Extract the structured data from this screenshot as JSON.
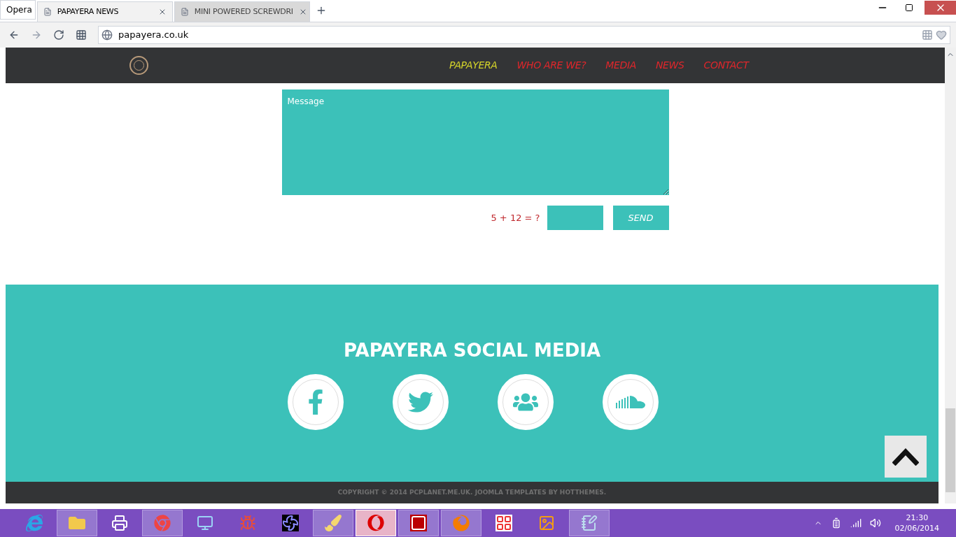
{
  "browser": {
    "brand": "Opera",
    "tabs": [
      {
        "label": "PAPAYERA NEWS",
        "selected": true
      },
      {
        "label": "MINI POWERED SCREWDRI",
        "selected": false
      }
    ],
    "address": "papayera.co.uk"
  },
  "nav": {
    "items": [
      {
        "label": "PAPAYERA",
        "selected": true
      },
      {
        "label": "WHO ARE WE?",
        "selected": false
      },
      {
        "label": "MEDIA",
        "selected": false
      },
      {
        "label": "NEWS",
        "selected": false
      },
      {
        "label": "CONTACT",
        "selected": false
      }
    ]
  },
  "form": {
    "message_placeholder": "Message",
    "captcha": "5 + 12 = ?",
    "send": "SEND"
  },
  "social": {
    "title": "PAPAYERA SOCIAL MEDIA",
    "links": [
      {
        "kind": "facebook"
      },
      {
        "kind": "twitter"
      },
      {
        "kind": "people"
      },
      {
        "kind": "soundcloud"
      }
    ]
  },
  "copyright": "COPYRIGHT © 2014 PCPLANET.ME.UK. **JOOMLA TEMPLATES** BY HOTTHEMES.",
  "taskbar": {
    "apps": [
      {
        "kind": "ie",
        "running": false,
        "selected": false
      },
      {
        "kind": "folder",
        "running": true,
        "selected": false
      },
      {
        "kind": "hp",
        "running": false,
        "selected": false
      },
      {
        "kind": "chrome",
        "running": true,
        "selected": false
      },
      {
        "kind": "panel",
        "running": false,
        "selected": false
      },
      {
        "kind": "ladybug",
        "running": false,
        "selected": false
      },
      {
        "kind": "fan",
        "running": false,
        "selected": false
      },
      {
        "kind": "paint",
        "running": true,
        "selected": false
      },
      {
        "kind": "opera",
        "running": true,
        "selected": true
      },
      {
        "kind": "filezilla",
        "running": true,
        "selected": false
      },
      {
        "kind": "firefox",
        "running": true,
        "selected": false
      },
      {
        "kind": "grid",
        "running": false,
        "selected": false
      },
      {
        "kind": "photos",
        "running": false,
        "selected": false
      },
      {
        "kind": "notepad",
        "running": true,
        "selected": false
      }
    ],
    "time": "21:30",
    "date": "02/06/2014"
  }
}
